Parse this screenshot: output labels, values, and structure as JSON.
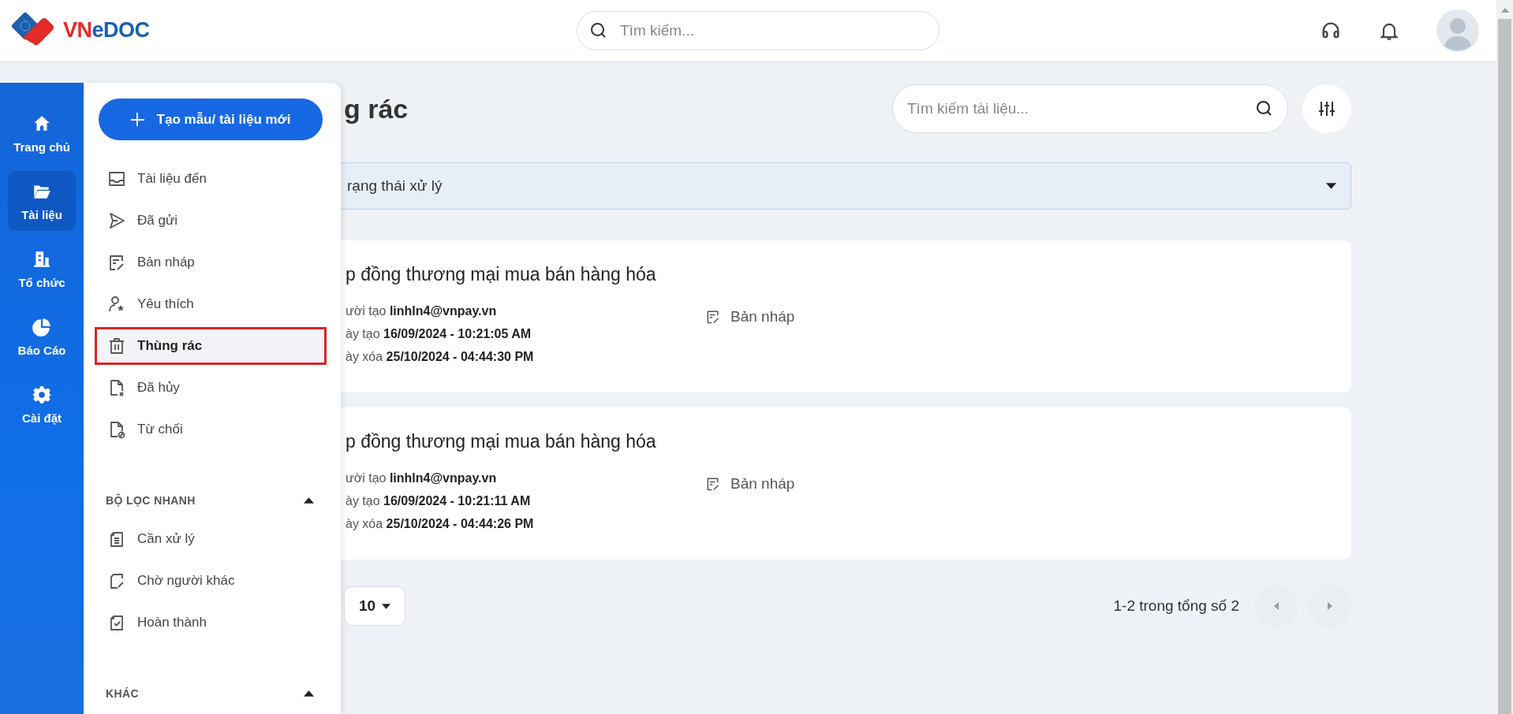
{
  "header": {
    "logo": "VNeDOC",
    "search": {
      "placeholder": "Tìm kiếm..."
    }
  },
  "rail": [
    {
      "label": "Trang chủ",
      "selected": false
    },
    {
      "label": "Tài liệu",
      "selected": true
    },
    {
      "label": "Tổ chức",
      "selected": false
    },
    {
      "label": "Báo Cáo",
      "selected": false
    },
    {
      "label": "Cài đặt",
      "selected": false
    }
  ],
  "menu": {
    "create_button": "Tạo mẫu/ tài liệu mới",
    "items": [
      {
        "label": "Tài liệu đến",
        "selected": false
      },
      {
        "label": "Đã gửi",
        "selected": false
      },
      {
        "label": "Bản nháp",
        "selected": false
      },
      {
        "label": "Yêu thích",
        "selected": false
      },
      {
        "label": "Thùng rác",
        "selected": true
      },
      {
        "label": "Đã hủy",
        "selected": false
      },
      {
        "label": "Từ chối",
        "selected": false
      }
    ],
    "sections": [
      {
        "title": "BỘ LỌC NHANH",
        "expanded": true,
        "items": [
          "Cần xử lý",
          "Chờ người khác",
          "Hoàn thành"
        ]
      },
      {
        "title": "KHÁC",
        "expanded": true
      }
    ]
  },
  "page": {
    "title": "g rác",
    "search": {
      "placeholder": "Tìm kiếm tài liệu..."
    },
    "status_filter": "rạng thái xử lý",
    "documents": [
      {
        "title": "p đồng thương mại mua bán hàng hóa",
        "fields": [
          {
            "label": "ười tạo",
            "value": "linhln4@vnpay.vn"
          },
          {
            "label": "ày tạo",
            "value": "16/09/2024 - 10:21:05 AM"
          },
          {
            "label": "ày xóa",
            "value": "25/10/2024 - 04:44:30 PM"
          }
        ],
        "status": "Bản nháp"
      },
      {
        "title": "p đồng thương mại mua bán hàng hóa",
        "fields": [
          {
            "label": "ười tạo",
            "value": "linhln4@vnpay.vn"
          },
          {
            "label": "ày tạo",
            "value": "16/09/2024 - 10:21:11 AM"
          },
          {
            "label": "ày xóa",
            "value": "25/10/2024 - 04:44:26 PM"
          }
        ],
        "status": "Bản nháp"
      }
    ]
  },
  "pagination": {
    "page_size": "10",
    "range": "1-2 trong tổng số 2"
  }
}
